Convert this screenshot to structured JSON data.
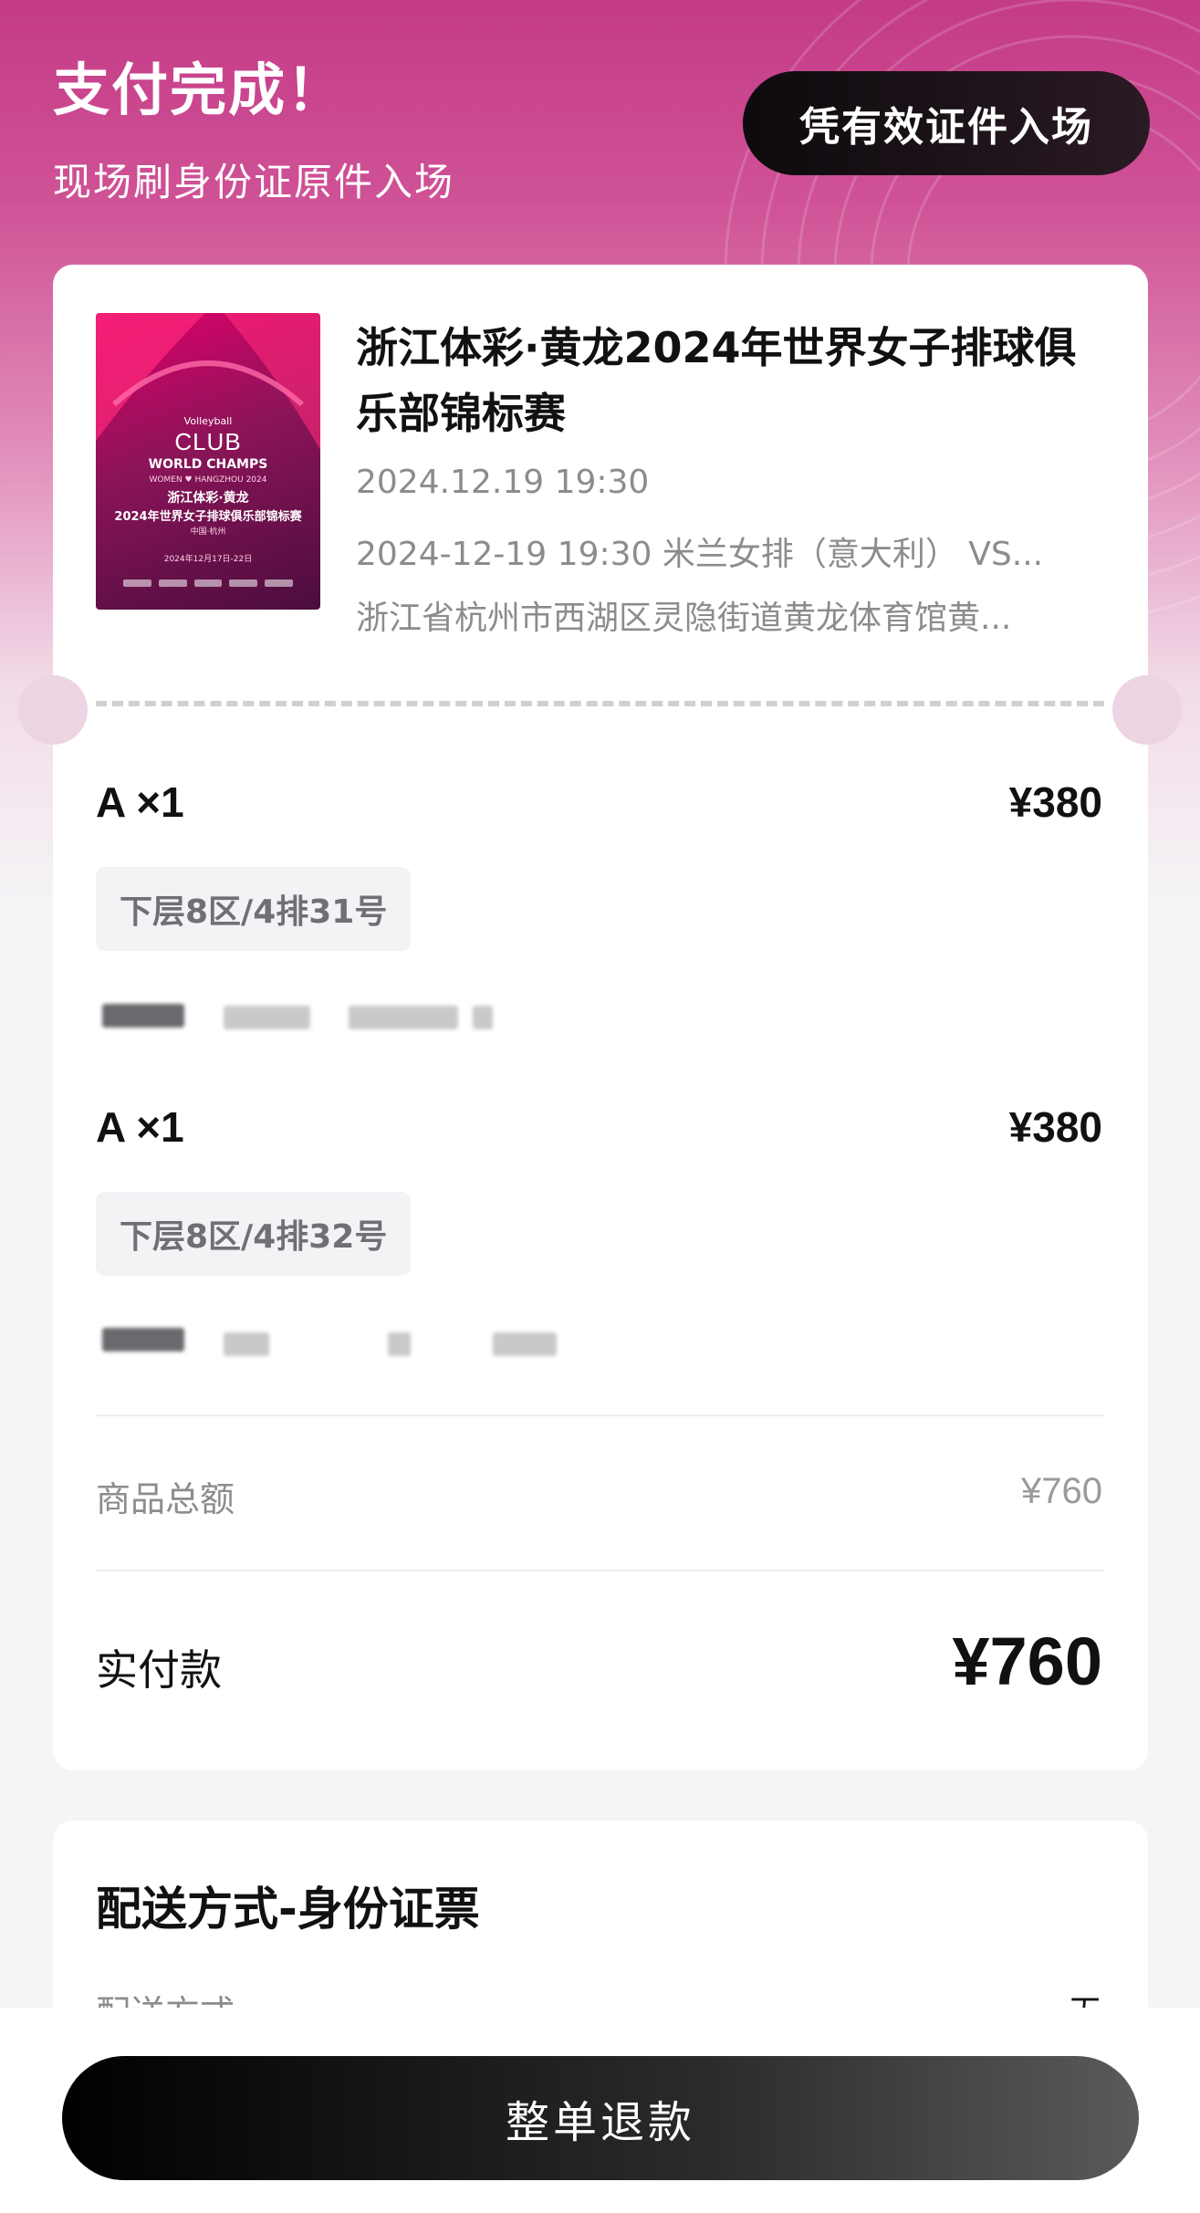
{
  "header": {
    "title": "支付完成！",
    "subtitle": "现场刷身份证原件入场",
    "entry_badge": "凭有效证件入场"
  },
  "event": {
    "title": "浙江体彩·黄龙2024年世界女子排球俱乐部锦标赛",
    "date": "2024.12.19 19:30",
    "session": "2024-12-19 19:30 米兰女排（意大利） VS...",
    "venue": "浙江省杭州市西湖区灵隐街道黄龙体育馆黄...",
    "poster": {
      "brand": "Volleyball",
      "club": "CLUB",
      "world_champs": "WORLD CHAMPS",
      "subline": "WOMEN ♥ HANGZHOU 2024",
      "cn_line1": "浙江体彩·黄龙",
      "cn_line2": "2024年世界女子排球俱乐部锦标赛",
      "city": "中国·杭州",
      "dates": "2024年12月17日-22日"
    }
  },
  "tickets": [
    {
      "tier": "A ×1",
      "price": "¥380",
      "seat": "下层8区/4排31号"
    },
    {
      "tier": "A ×1",
      "price": "¥380",
      "seat": "下层8区/4排32号"
    }
  ],
  "summary": {
    "goods_total_label": "商品总额",
    "goods_total_value": "¥760",
    "paid_label": "实付款",
    "paid_value": "¥760"
  },
  "delivery": {
    "title": "配送方式-身份证票",
    "row_label": "配送方式",
    "row_value": "无"
  },
  "actions": {
    "refund_label": "整单退款"
  },
  "colors": {
    "hero_top": "#c43b86",
    "hero_mid": "#e08ab8",
    "page_bg": "#f5f5f7",
    "pill_bg": "#0d0a0d"
  }
}
